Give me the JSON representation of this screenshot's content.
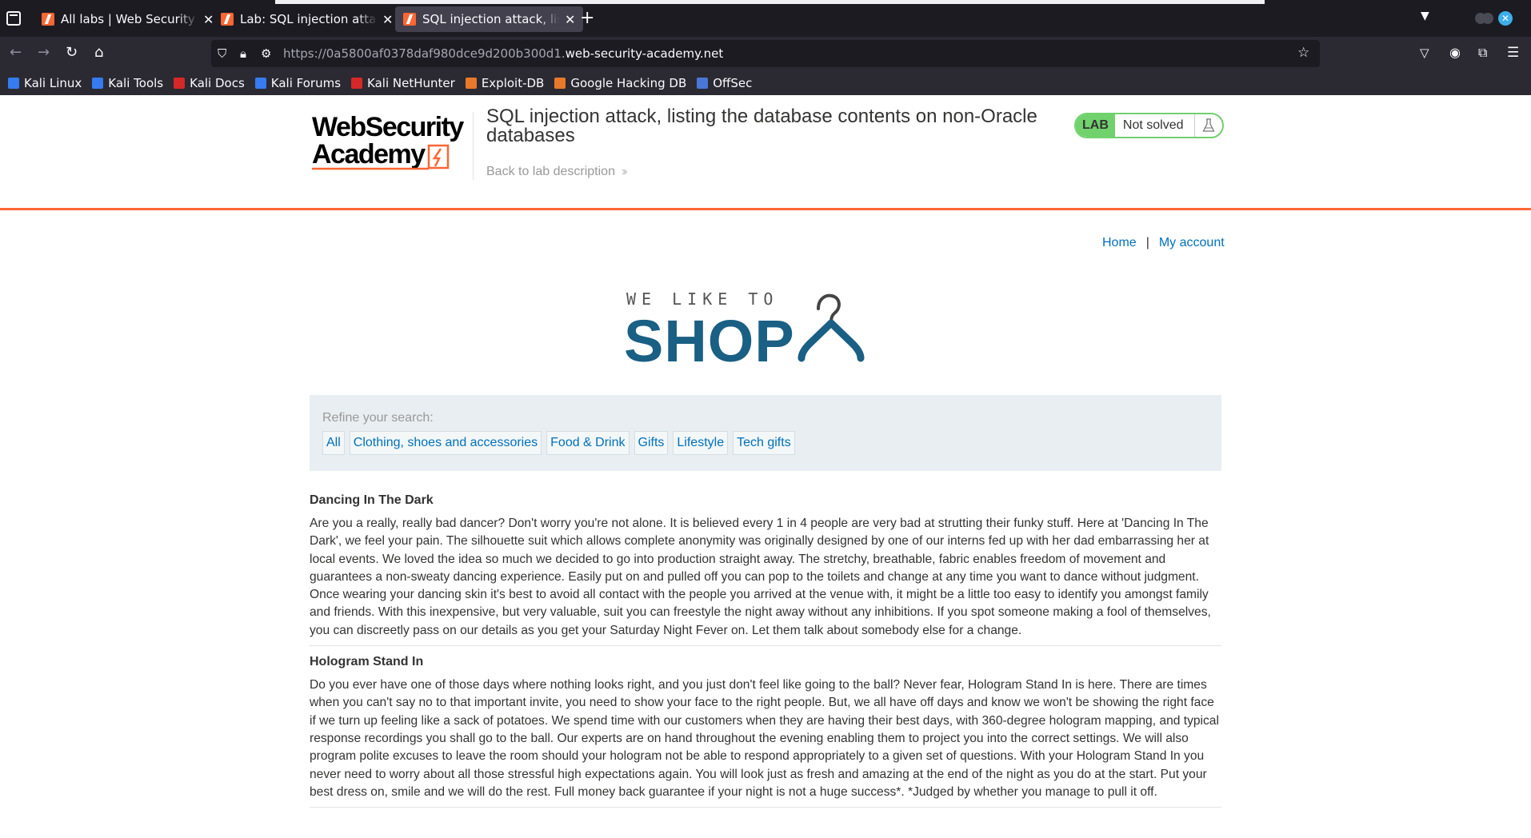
{
  "browser": {
    "tabs": [
      {
        "title": "All labs | Web Security Academy",
        "active": false
      },
      {
        "title": "Lab: SQL injection attack, listing",
        "active": false
      },
      {
        "title": "SQL injection attack, listing",
        "active": true
      }
    ],
    "new_tab_label": "+",
    "url_prefix": "https://0a5800af0378daf980dce9d200b300d1.",
    "url_domain": "web-security-academy.net",
    "bookmarks": [
      {
        "label": "Kali Linux",
        "color": "#367bf0"
      },
      {
        "label": "Kali Tools",
        "color": "#367bf0"
      },
      {
        "label": "Kali Docs",
        "color": "#d62828"
      },
      {
        "label": "Kali Forums",
        "color": "#367bf0"
      },
      {
        "label": "Kali NetHunter",
        "color": "#d62828"
      },
      {
        "label": "Exploit-DB",
        "color": "#e8792b"
      },
      {
        "label": "Google Hacking DB",
        "color": "#e8792b"
      },
      {
        "label": "OffSec",
        "color": "#4a76d6"
      }
    ]
  },
  "lab": {
    "logo_line1": "WebSecurity",
    "logo_line2": "Academy",
    "title": "SQL injection attack, listing the database contents on non-Oracle databases",
    "back_link": "Back to lab description",
    "badge": "LAB",
    "status": "Not solved",
    "accent_color": "#ff6633",
    "status_color": "#70d16d"
  },
  "shop": {
    "nav": {
      "home": "Home",
      "separator": "|",
      "account": "My account"
    },
    "logo_top": "WE LIKE TO",
    "logo_main": "SHOP",
    "filter_label": "Refine your search:",
    "filters": [
      "All",
      "Clothing, shoes and accessories",
      "Food & Drink",
      "Gifts",
      "Lifestyle",
      "Tech gifts"
    ],
    "products": [
      {
        "name": "Dancing In The Dark",
        "description": "Are you a really, really bad dancer? Don't worry you're not alone. It is believed every 1 in 4 people are very bad at strutting their funky stuff. Here at 'Dancing In The Dark', we feel your pain. The silhouette suit which allows complete anonymity was originally designed by one of our interns fed up with her dad embarrassing her at local events. We loved the idea so much we decided to go into production straight away. The stretchy, breathable, fabric enables freedom of movement and guarantees a non-sweaty dancing experience. Easily put on and pulled off you can pop to the toilets and change at any time you want to dance without judgment. Once wearing your dancing skin it's best to avoid all contact with the people you arrived at the venue with, it might be a little too easy to identify you amongst family and friends. With this inexpensive, but very valuable, suit you can freestyle the night away without any inhibitions. If you spot someone making a fool of themselves, you can discreetly pass on our details as you get your Saturday Night Fever on. Let them talk about somebody else for a change."
      },
      {
        "name": "Hologram Stand In",
        "description": "Do you ever have one of those days where nothing looks right, and you just don't feel like going to the ball? Never fear, Hologram Stand In is here. There are times when you can't say no to that important invite, you need to show your face to the right people. But, we all have off days and know we won't be showing the right face if we turn up feeling like a sack of potatoes. We spend time with our customers when they are having their best days, with 360-degree hologram mapping, and typical response recordings you shall go to the ball. Our experts are on hand throughout the evening enabling them to project you into the correct settings. We will also program polite excuses to leave the room should your hologram not be able to respond appropriately to a given set of questions. With your Hologram Stand In you never need to worry about all those stressful high expectations again. You will look just as fresh and amazing at the end of the night as you do at the start. Put your best dress on, smile and we will do the rest. Full money back guarantee if your night is not a huge success*. *Judged by whether you manage to pull it off."
      }
    ]
  }
}
